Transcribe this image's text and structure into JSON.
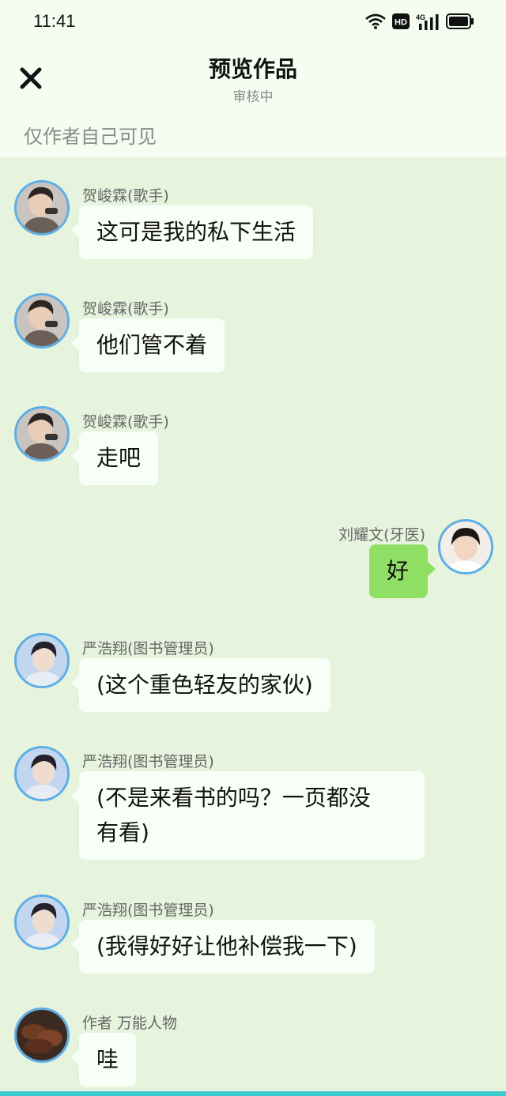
{
  "status": {
    "time": "11:41",
    "icons": [
      "wifi-icon",
      "hd-icon",
      "4g-signal-icon",
      "battery-icon"
    ],
    "hd_label": "HD",
    "network_label": "4G"
  },
  "header": {
    "close_icon": "close-icon",
    "title": "预览作品",
    "subtitle": "审核中",
    "visibility": "仅作者自己可见"
  },
  "messages": [
    {
      "sender": "贺峻霖(歌手)",
      "text": "这可是我的私下生活",
      "side": "left"
    },
    {
      "sender": "贺峻霖(歌手)",
      "text": "他们管不着",
      "side": "left"
    },
    {
      "sender": "贺峻霖(歌手)",
      "text": "走吧",
      "side": "left"
    },
    {
      "sender": "刘耀文(牙医)",
      "text": "好",
      "side": "right"
    },
    {
      "sender": "严浩翔(图书管理员)",
      "text": "(这个重色轻友的家伙)",
      "side": "left"
    },
    {
      "sender": "严浩翔(图书管理员)",
      "text_line1": "(不是来看书的吗？一页都没",
      "text_line2": "有看)",
      "side": "left"
    },
    {
      "sender": "严浩翔(图书管理员)",
      "text": "(我得好好让他补偿我一下)",
      "side": "left"
    },
    {
      "sender": "作者 万能人物",
      "text": "哇",
      "side": "left"
    }
  ],
  "colors": {
    "background": "#e6f4de",
    "header_bg": "#f4fdf0",
    "left_bubble": "#f8fff6",
    "right_bubble": "#8fdf64",
    "avatar_border": "#5eaee6",
    "bottom_bar": "#3ecbd0"
  }
}
